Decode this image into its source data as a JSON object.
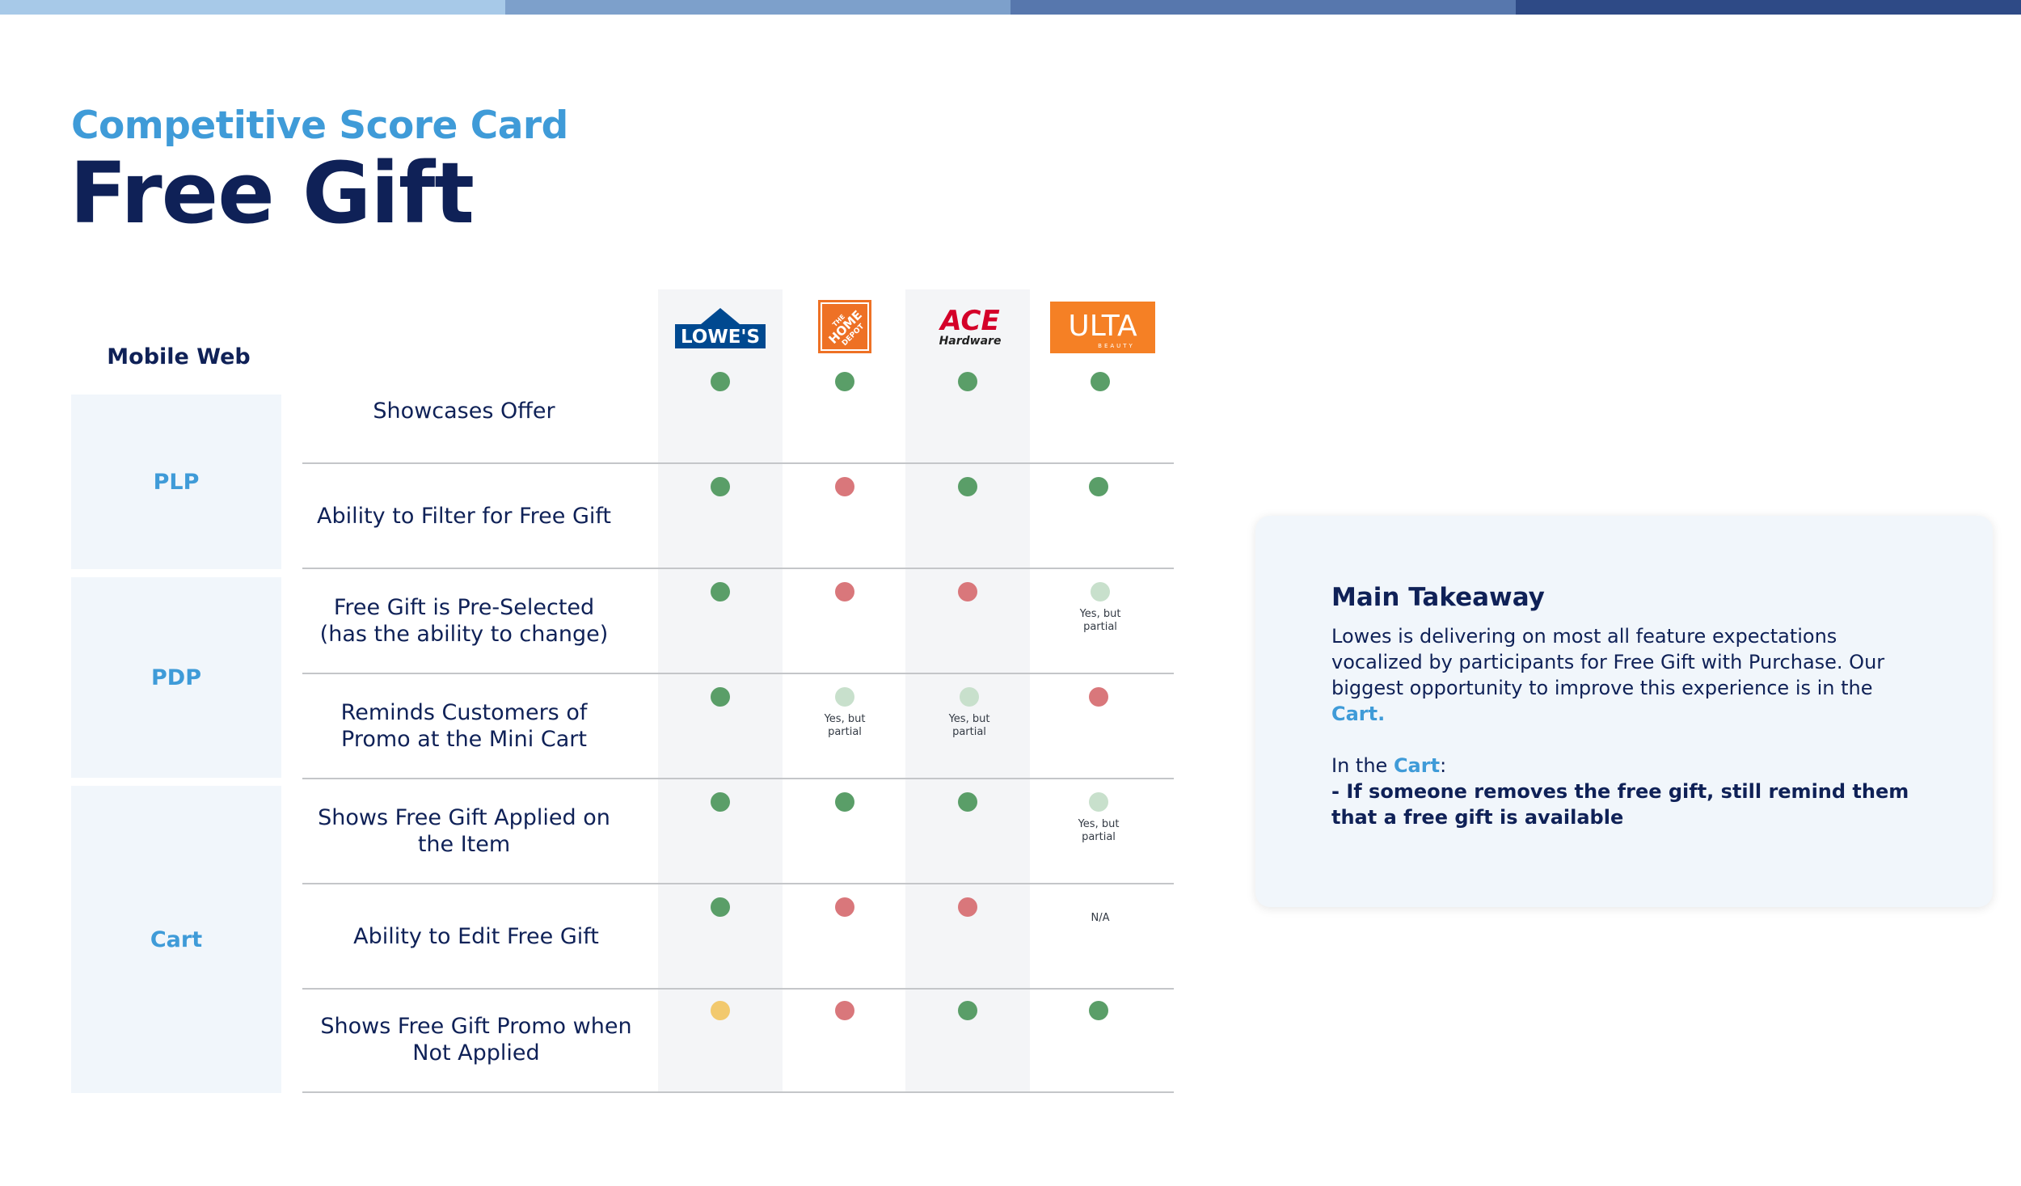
{
  "header": {
    "subtitle": "Competitive Score Card",
    "title": "Free Gift"
  },
  "colors": {
    "top_bar": [
      "#a7c9e8",
      "#7da0cb",
      "#5777ad",
      "#2e4a86"
    ],
    "accent": "#3f9bd8",
    "navy": "#0f2157",
    "positive": "#5a9e68",
    "negative": "#d9777b",
    "neutral": "#f2c96e",
    "partial": "#c8e0cc"
  },
  "table": {
    "section_label": "Mobile Web",
    "competitors": [
      {
        "name": "Lowe's",
        "logo_text": "LOWE'S",
        "color": "#004990"
      },
      {
        "name": "The Home Depot",
        "logo_text": "THE HOME DEPOT",
        "color": "#ee7125"
      },
      {
        "name": "Ace Hardware",
        "logo_text": "ACE",
        "logo_sub": "Hardware",
        "color": "#d40029"
      },
      {
        "name": "Ulta Beauty",
        "logo_text": "ULTA",
        "logo_sub": "BEAUTY",
        "color": "#f58025"
      }
    ],
    "groups": [
      {
        "label": "PLP"
      },
      {
        "label": "PDP"
      },
      {
        "label": "Cart"
      }
    ],
    "rows": [
      {
        "feature": "Showcases Offer",
        "scores": [
          {
            "status": "green",
            "note": ""
          },
          {
            "status": "green",
            "note": ""
          },
          {
            "status": "green",
            "note": ""
          },
          {
            "status": "green",
            "note": ""
          }
        ]
      },
      {
        "feature": "Ability to Filter for Free Gift",
        "scores": [
          {
            "status": "green",
            "note": ""
          },
          {
            "status": "red",
            "note": ""
          },
          {
            "status": "green",
            "note": ""
          },
          {
            "status": "green",
            "note": ""
          }
        ]
      },
      {
        "feature": "Free Gift is Pre-Selected (has the ability to change)",
        "scores": [
          {
            "status": "green",
            "note": ""
          },
          {
            "status": "red",
            "note": ""
          },
          {
            "status": "red",
            "note": ""
          },
          {
            "status": "lightgreen",
            "note": "Yes, but partial"
          }
        ]
      },
      {
        "feature": "Reminds Customers of Promo at the Mini Cart",
        "scores": [
          {
            "status": "green",
            "note": ""
          },
          {
            "status": "lightgreen",
            "note": "Yes, but partial"
          },
          {
            "status": "lightgreen",
            "note": "Yes, but partial"
          },
          {
            "status": "red",
            "note": ""
          }
        ]
      },
      {
        "feature": "Shows Free Gift Applied on the Item",
        "scores": [
          {
            "status": "green",
            "note": ""
          },
          {
            "status": "green",
            "note": ""
          },
          {
            "status": "green",
            "note": ""
          },
          {
            "status": "lightgreen",
            "note": "Yes, but partial"
          }
        ]
      },
      {
        "feature": "Ability to Edit Free Gift",
        "scores": [
          {
            "status": "green",
            "note": ""
          },
          {
            "status": "red",
            "note": ""
          },
          {
            "status": "red",
            "note": ""
          },
          {
            "status": "none",
            "note": "N/A"
          }
        ]
      },
      {
        "feature": "Shows Free Gift Promo when Not Applied",
        "scores": [
          {
            "status": "yellow",
            "note": ""
          },
          {
            "status": "red",
            "note": ""
          },
          {
            "status": "green",
            "note": ""
          },
          {
            "status": "green",
            "note": ""
          }
        ]
      }
    ]
  },
  "takeaway": {
    "title": "Main Takeaway",
    "body_text": "Lowes is delivering on most all feature expectations vocalized by participants for Free Gift with Purchase. Our biggest opportunity to improve this experience is in the ",
    "body_highlight": "Cart.",
    "cart_prefix": "In the ",
    "cart_highlight": "Cart",
    "cart_suffix": ":",
    "bullet": "- If someone removes the free gift, still remind them that a free gift is available"
  }
}
